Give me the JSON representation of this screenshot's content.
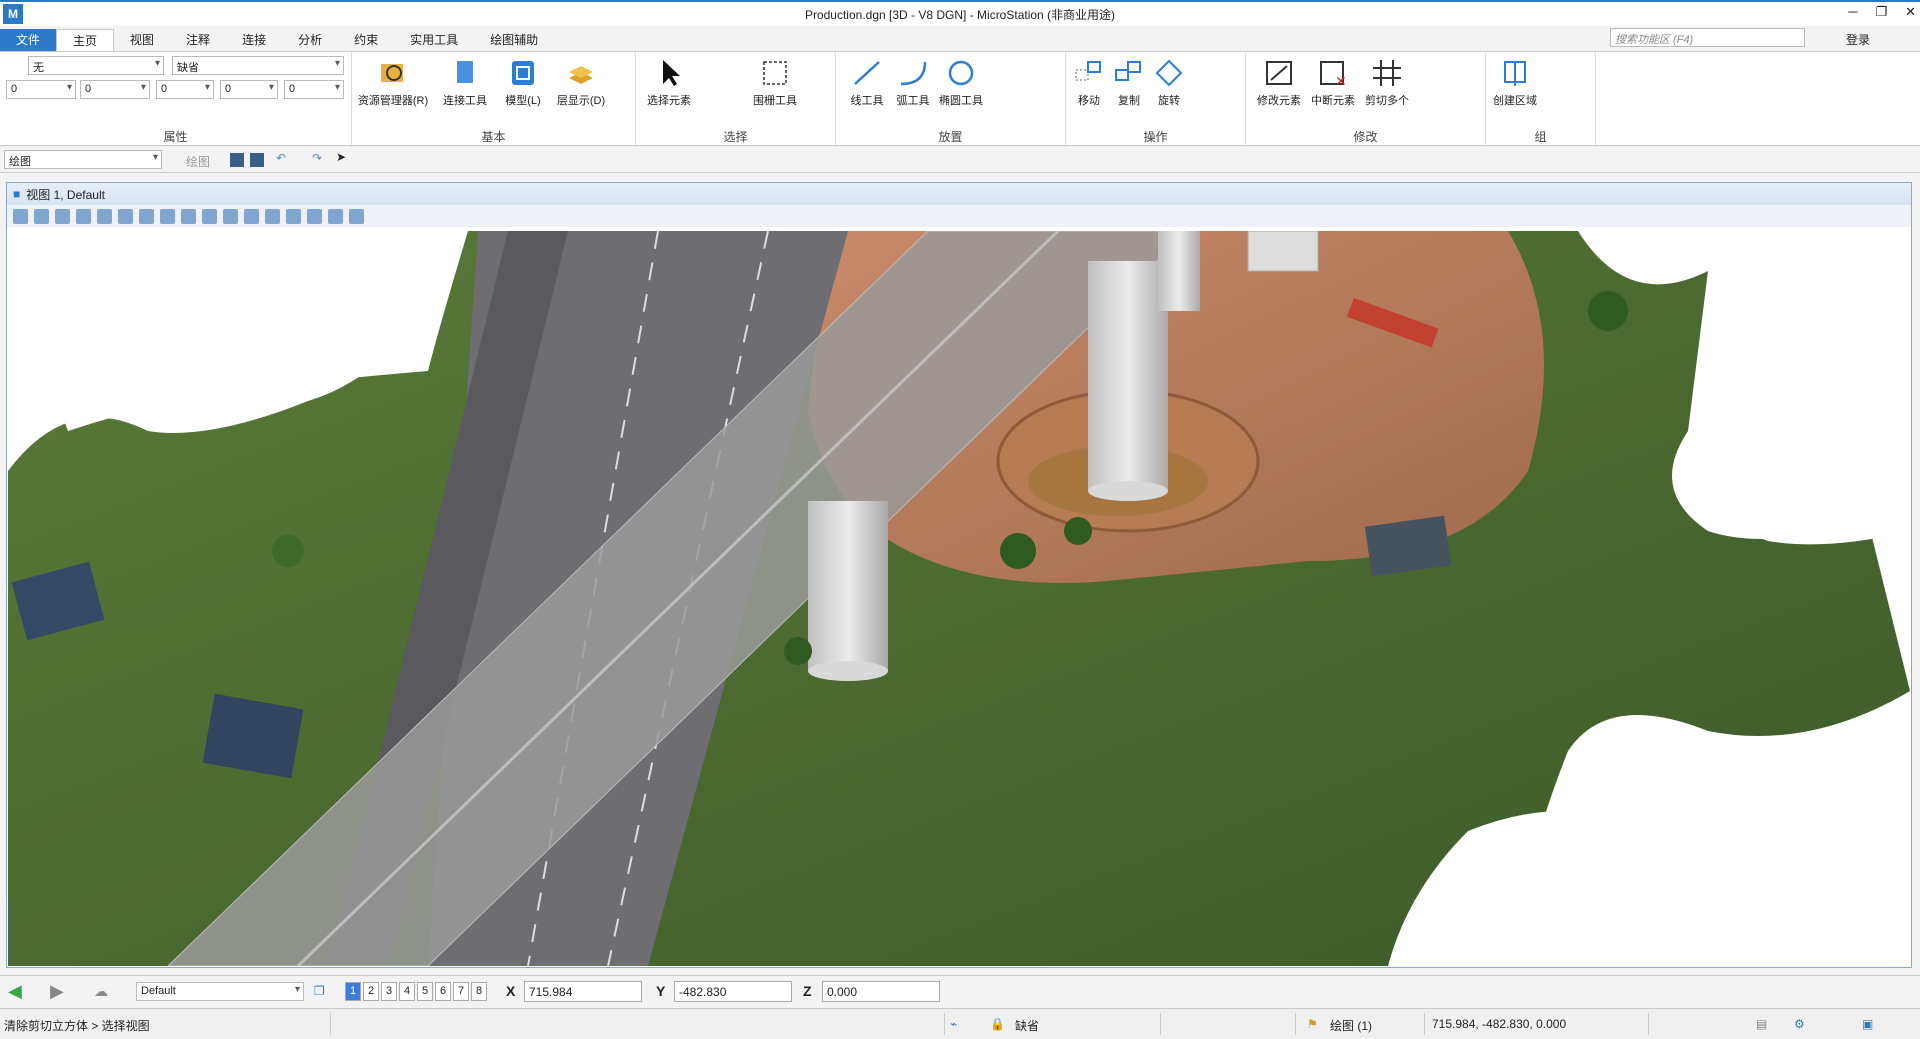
{
  "window": {
    "title": "Production.dgn [3D - V8 DGN] - MicroStation (非商业用途)",
    "logo": "M",
    "minimize": "─",
    "restore": "❐",
    "close": "✕"
  },
  "ribbon_tabs": [
    "文件",
    "主页",
    "视图",
    "注释",
    "连接",
    "分析",
    "约束",
    "实用工具",
    "绘图辅助"
  ],
  "search": {
    "placeholder": "搜索功能区 (F4)"
  },
  "login": "登录",
  "attributes": {
    "level": "无",
    "style": "缺省",
    "color": "0",
    "linestyle": "0",
    "weight": "0",
    "transparency": "0",
    "priority": "0",
    "label": "属性"
  },
  "basic": {
    "btn1": "资源管理器(R)",
    "btn2": "连接工具",
    "btn3": "模型(L)",
    "btn4": "层显示(D)",
    "label": "基本"
  },
  "select": {
    "btn1": "选择元素",
    "btn2": "围栅工具",
    "label": "选择"
  },
  "place": {
    "btn1": "线工具",
    "btn2": "弧工具",
    "btn3": "椭圆工具",
    "label": "放置"
  },
  "manipulate": {
    "btn1": "移动",
    "btn2": "复制",
    "btn3": "旋转",
    "label": "操作"
  },
  "modify": {
    "btn1": "修改元素",
    "btn2": "中断元素",
    "btn3": "剪切多个",
    "label": "修改"
  },
  "groups": {
    "btn1": "创建区域",
    "label": "组"
  },
  "toolbar2": {
    "model": "绘图",
    "label": "绘图"
  },
  "view": {
    "title": "视图 1, Default"
  },
  "statusbar": {
    "view_group": "Default",
    "views": [
      "1",
      "2",
      "3",
      "4",
      "5",
      "6",
      "7",
      "8"
    ],
    "x_label": "X",
    "x_value": "715.984",
    "y_label": "Y",
    "y_value": "-482.830",
    "z_label": "Z",
    "z_value": "0.000",
    "prompt": "清除剪切立方体 > 选择视图",
    "level": "缺省",
    "model": "绘图 (1)",
    "coords": "715.984, -482.830, 0.000"
  }
}
